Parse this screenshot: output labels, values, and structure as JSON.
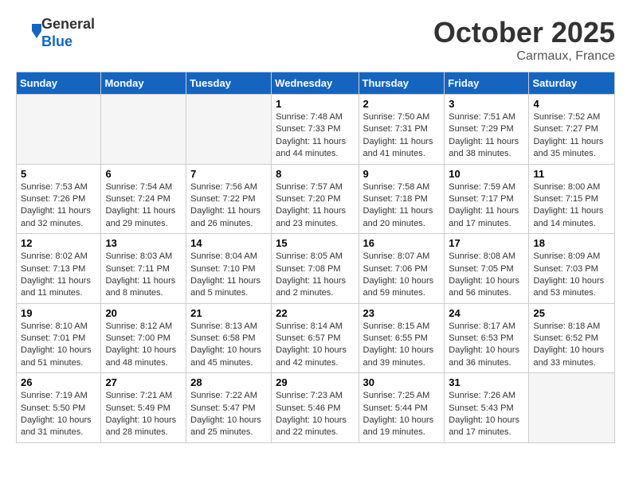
{
  "header": {
    "logo_line1": "General",
    "logo_line2": "Blue",
    "month": "October 2025",
    "location": "Carmaux, France"
  },
  "weekdays": [
    "Sunday",
    "Monday",
    "Tuesday",
    "Wednesday",
    "Thursday",
    "Friday",
    "Saturday"
  ],
  "weeks": [
    [
      {
        "day": "",
        "info": ""
      },
      {
        "day": "",
        "info": ""
      },
      {
        "day": "",
        "info": ""
      },
      {
        "day": "1",
        "info": "Sunrise: 7:48 AM\nSunset: 7:33 PM\nDaylight: 11 hours\nand 44 minutes."
      },
      {
        "day": "2",
        "info": "Sunrise: 7:50 AM\nSunset: 7:31 PM\nDaylight: 11 hours\nand 41 minutes."
      },
      {
        "day": "3",
        "info": "Sunrise: 7:51 AM\nSunset: 7:29 PM\nDaylight: 11 hours\nand 38 minutes."
      },
      {
        "day": "4",
        "info": "Sunrise: 7:52 AM\nSunset: 7:27 PM\nDaylight: 11 hours\nand 35 minutes."
      }
    ],
    [
      {
        "day": "5",
        "info": "Sunrise: 7:53 AM\nSunset: 7:26 PM\nDaylight: 11 hours\nand 32 minutes."
      },
      {
        "day": "6",
        "info": "Sunrise: 7:54 AM\nSunset: 7:24 PM\nDaylight: 11 hours\nand 29 minutes."
      },
      {
        "day": "7",
        "info": "Sunrise: 7:56 AM\nSunset: 7:22 PM\nDaylight: 11 hours\nand 26 minutes."
      },
      {
        "day": "8",
        "info": "Sunrise: 7:57 AM\nSunset: 7:20 PM\nDaylight: 11 hours\nand 23 minutes."
      },
      {
        "day": "9",
        "info": "Sunrise: 7:58 AM\nSunset: 7:18 PM\nDaylight: 11 hours\nand 20 minutes."
      },
      {
        "day": "10",
        "info": "Sunrise: 7:59 AM\nSunset: 7:17 PM\nDaylight: 11 hours\nand 17 minutes."
      },
      {
        "day": "11",
        "info": "Sunrise: 8:00 AM\nSunset: 7:15 PM\nDaylight: 11 hours\nand 14 minutes."
      }
    ],
    [
      {
        "day": "12",
        "info": "Sunrise: 8:02 AM\nSunset: 7:13 PM\nDaylight: 11 hours\nand 11 minutes."
      },
      {
        "day": "13",
        "info": "Sunrise: 8:03 AM\nSunset: 7:11 PM\nDaylight: 11 hours\nand 8 minutes."
      },
      {
        "day": "14",
        "info": "Sunrise: 8:04 AM\nSunset: 7:10 PM\nDaylight: 11 hours\nand 5 minutes."
      },
      {
        "day": "15",
        "info": "Sunrise: 8:05 AM\nSunset: 7:08 PM\nDaylight: 11 hours\nand 2 minutes."
      },
      {
        "day": "16",
        "info": "Sunrise: 8:07 AM\nSunset: 7:06 PM\nDaylight: 10 hours\nand 59 minutes."
      },
      {
        "day": "17",
        "info": "Sunrise: 8:08 AM\nSunset: 7:05 PM\nDaylight: 10 hours\nand 56 minutes."
      },
      {
        "day": "18",
        "info": "Sunrise: 8:09 AM\nSunset: 7:03 PM\nDaylight: 10 hours\nand 53 minutes."
      }
    ],
    [
      {
        "day": "19",
        "info": "Sunrise: 8:10 AM\nSunset: 7:01 PM\nDaylight: 10 hours\nand 51 minutes."
      },
      {
        "day": "20",
        "info": "Sunrise: 8:12 AM\nSunset: 7:00 PM\nDaylight: 10 hours\nand 48 minutes."
      },
      {
        "day": "21",
        "info": "Sunrise: 8:13 AM\nSunset: 6:58 PM\nDaylight: 10 hours\nand 45 minutes."
      },
      {
        "day": "22",
        "info": "Sunrise: 8:14 AM\nSunset: 6:57 PM\nDaylight: 10 hours\nand 42 minutes."
      },
      {
        "day": "23",
        "info": "Sunrise: 8:15 AM\nSunset: 6:55 PM\nDaylight: 10 hours\nand 39 minutes."
      },
      {
        "day": "24",
        "info": "Sunrise: 8:17 AM\nSunset: 6:53 PM\nDaylight: 10 hours\nand 36 minutes."
      },
      {
        "day": "25",
        "info": "Sunrise: 8:18 AM\nSunset: 6:52 PM\nDaylight: 10 hours\nand 33 minutes."
      }
    ],
    [
      {
        "day": "26",
        "info": "Sunrise: 7:19 AM\nSunset: 5:50 PM\nDaylight: 10 hours\nand 31 minutes."
      },
      {
        "day": "27",
        "info": "Sunrise: 7:21 AM\nSunset: 5:49 PM\nDaylight: 10 hours\nand 28 minutes."
      },
      {
        "day": "28",
        "info": "Sunrise: 7:22 AM\nSunset: 5:47 PM\nDaylight: 10 hours\nand 25 minutes."
      },
      {
        "day": "29",
        "info": "Sunrise: 7:23 AM\nSunset: 5:46 PM\nDaylight: 10 hours\nand 22 minutes."
      },
      {
        "day": "30",
        "info": "Sunrise: 7:25 AM\nSunset: 5:44 PM\nDaylight: 10 hours\nand 19 minutes."
      },
      {
        "day": "31",
        "info": "Sunrise: 7:26 AM\nSunset: 5:43 PM\nDaylight: 10 hours\nand 17 minutes."
      },
      {
        "day": "",
        "info": ""
      }
    ]
  ]
}
